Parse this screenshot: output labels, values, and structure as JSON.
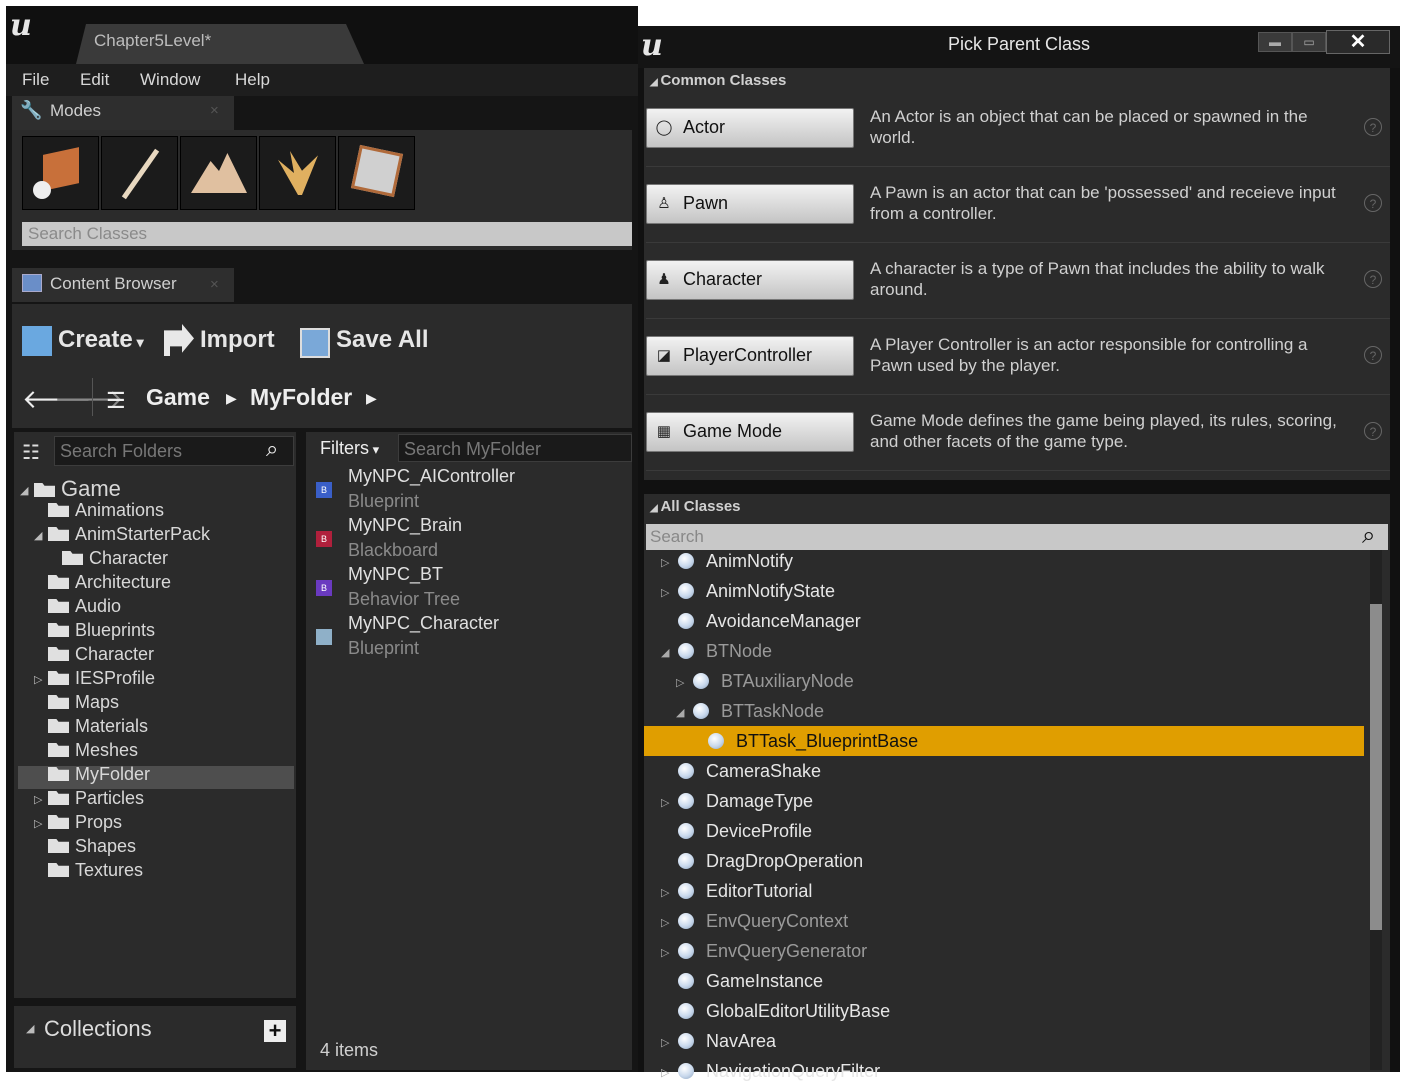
{
  "editor": {
    "level_tab": "Chapter5Level*",
    "menu": [
      "File",
      "Edit",
      "Window",
      "Help"
    ],
    "modes_tab": "Modes",
    "modes_close": "×",
    "mode_buttons": [
      "place-mode",
      "paint-mode",
      "landscape-mode",
      "foliage-mode",
      "geometry-mode"
    ],
    "search_classes_placeholder": "Search Classes"
  },
  "content_browser": {
    "tab": "Content Browser",
    "tab_close": "×",
    "toolbar": {
      "create": "Create",
      "import": "Import",
      "save_all": "Save All"
    },
    "path": [
      "Game",
      "MyFolder"
    ],
    "search_folders_placeholder": "Search Folders",
    "filters_label": "Filters",
    "search_myfolder_placeholder": "Search MyFolder",
    "tree": [
      {
        "label": "Game",
        "level": 0,
        "expanded": true
      },
      {
        "label": "Animations",
        "level": 1
      },
      {
        "label": "AnimStarterPack",
        "level": 1,
        "expanded": true
      },
      {
        "label": "Character",
        "level": 2
      },
      {
        "label": "Architecture",
        "level": 1
      },
      {
        "label": "Audio",
        "level": 1
      },
      {
        "label": "Blueprints",
        "level": 1
      },
      {
        "label": "Character",
        "level": 1
      },
      {
        "label": "IESProfile",
        "level": 1,
        "collapsed": true
      },
      {
        "label": "Maps",
        "level": 1
      },
      {
        "label": "Materials",
        "level": 1
      },
      {
        "label": "Meshes",
        "level": 1
      },
      {
        "label": "MyFolder",
        "level": 1,
        "selected": true
      },
      {
        "label": "Particles",
        "level": 1,
        "collapsed": true
      },
      {
        "label": "Props",
        "level": 1,
        "collapsed": true
      },
      {
        "label": "Shapes",
        "level": 1
      },
      {
        "label": "Textures",
        "level": 1
      }
    ],
    "assets": [
      {
        "name": "MyNPC_AIController",
        "type": "Blueprint",
        "badge": "B",
        "color": "#3a5fc8"
      },
      {
        "name": "MyNPC_Brain",
        "type": "Blackboard",
        "badge": "B",
        "color": "#b0203c"
      },
      {
        "name": "MyNPC_BT",
        "type": "Behavior Tree",
        "badge": "B",
        "color": "#6a3ac0"
      },
      {
        "name": "MyNPC_Character",
        "type": "Blueprint",
        "badge": "",
        "color": "#8fb0c8"
      }
    ],
    "collections_label": "Collections",
    "item_count": "4 items"
  },
  "dialog": {
    "title": "Pick Parent Class",
    "minimize": "▬",
    "maximize": "▭",
    "close": "✕",
    "common_header": "Common Classes",
    "common_classes": [
      {
        "label": "Actor",
        "icon": "actor-icon",
        "glyph": "◯",
        "desc": "An Actor is an object that can be placed or spawned in the world."
      },
      {
        "label": "Pawn",
        "icon": "pawn-icon",
        "glyph": "♙",
        "desc": "A Pawn is an actor that can be 'possessed' and receieve input from a controller."
      },
      {
        "label": "Character",
        "icon": "character-icon",
        "glyph": "♟",
        "desc": "A character is a type of Pawn that includes the ability to walk around."
      },
      {
        "label": "PlayerController",
        "icon": "controller-icon",
        "glyph": "◪",
        "desc": "A Player Controller is an actor responsible for controlling a Pawn used by the player."
      },
      {
        "label": "Game Mode",
        "icon": "gamemode-icon",
        "glyph": "▦",
        "desc": "Game Mode defines the game being played, its rules, scoring, and other facets of the game type."
      }
    ],
    "help_glyph": "?",
    "all_header": "All Classes",
    "all_search_placeholder": "Search",
    "classes": [
      {
        "label": "AnimNotify",
        "indent": 0,
        "arrow": "▷",
        "dim": false
      },
      {
        "label": "AnimNotifyState",
        "indent": 0,
        "arrow": "▷",
        "dim": false
      },
      {
        "label": "AvoidanceManager",
        "indent": 0,
        "arrow": "",
        "dim": false
      },
      {
        "label": "BTNode",
        "indent": 0,
        "arrow": "◢",
        "dim": true
      },
      {
        "label": "BTAuxiliaryNode",
        "indent": 1,
        "arrow": "▷",
        "dim": true
      },
      {
        "label": "BTTaskNode",
        "indent": 1,
        "arrow": "◢",
        "dim": true
      },
      {
        "label": "BTTask_BlueprintBase",
        "indent": 2,
        "arrow": "",
        "dim": false,
        "selected": true
      },
      {
        "label": "CameraShake",
        "indent": 0,
        "arrow": "",
        "dim": false
      },
      {
        "label": "DamageType",
        "indent": 0,
        "arrow": "▷",
        "dim": false
      },
      {
        "label": "DeviceProfile",
        "indent": 0,
        "arrow": "",
        "dim": false
      },
      {
        "label": "DragDropOperation",
        "indent": 0,
        "arrow": "",
        "dim": false
      },
      {
        "label": "EditorTutorial",
        "indent": 0,
        "arrow": "▷",
        "dim": false
      },
      {
        "label": "EnvQueryContext",
        "indent": 0,
        "arrow": "▷",
        "dim": true
      },
      {
        "label": "EnvQueryGenerator",
        "indent": 0,
        "arrow": "▷",
        "dim": true
      },
      {
        "label": "GameInstance",
        "indent": 0,
        "arrow": "",
        "dim": false
      },
      {
        "label": "GlobalEditorUtilityBase",
        "indent": 0,
        "arrow": "",
        "dim": false
      },
      {
        "label": "NavArea",
        "indent": 0,
        "arrow": "▷",
        "dim": false
      },
      {
        "label": "NavigationQueryFilter",
        "indent": 0,
        "arrow": "▷",
        "dim": false
      }
    ]
  },
  "colors": {
    "selection": "#e09e00",
    "panel": "#2b2b2b",
    "background": "#151515"
  }
}
